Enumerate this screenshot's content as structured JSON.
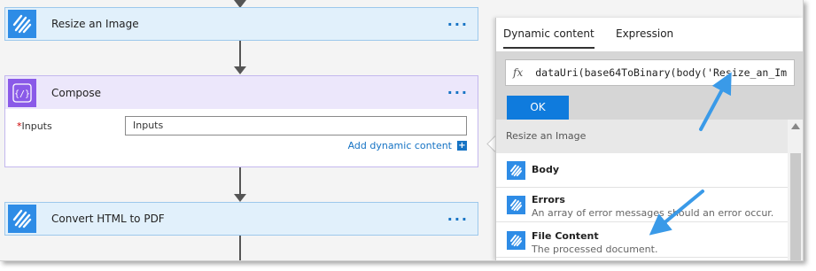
{
  "flow": {
    "steps": [
      {
        "title": "Resize an Image",
        "menu": "···"
      },
      {
        "title": "Compose",
        "menu": "···"
      },
      {
        "title": "Convert HTML to PDF",
        "menu": "···"
      }
    ],
    "compose": {
      "required_mark": "*",
      "inputs_label": "Inputs",
      "inputs_placeholder": "Inputs",
      "add_dynamic_content": "Add dynamic content",
      "add_icon": "+"
    }
  },
  "panel": {
    "tabs": [
      "Dynamic content",
      "Expression"
    ],
    "active_tab": "Dynamic content",
    "fx_symbol": "fx",
    "expression_value": "dataUri(base64ToBinary(body('Resize_an_Im",
    "ok_label": "OK",
    "section_title": "Resize an Image",
    "items": [
      {
        "name": "Body",
        "description": ""
      },
      {
        "name": "Errors",
        "description": "An array of error messages should an error occur."
      },
      {
        "name": "File Content",
        "description": "The processed document."
      }
    ]
  },
  "colors": {
    "accent_blue": "#0f7bdd",
    "hiqpdf_icon": "#2e8ce6",
    "compose_icon": "#8a5ae8",
    "callout_arrow": "#3a9ae8"
  },
  "icons": {
    "hiqpdf": "diagonal-stripes-icon",
    "compose": "curly-braces-icon"
  }
}
